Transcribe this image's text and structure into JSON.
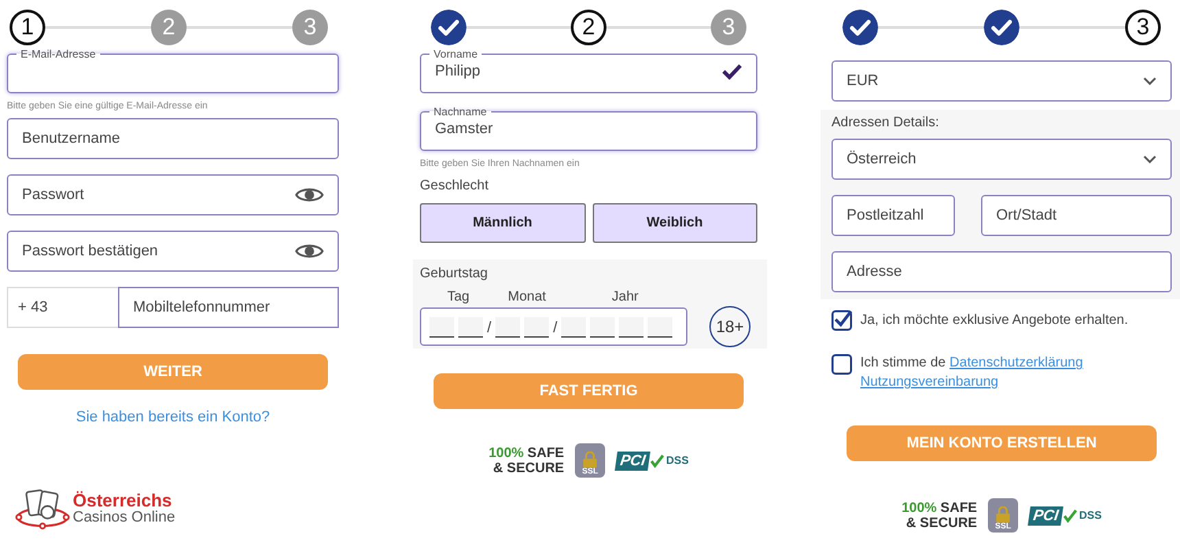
{
  "panels": [
    {
      "kind": "account",
      "steps": [
        {
          "done": false,
          "current": true,
          "label": "1"
        },
        {
          "done": false,
          "current": false,
          "label": "2"
        },
        {
          "done": false,
          "current": false,
          "label": "3"
        }
      ],
      "email": {
        "label": "E-Mail-Adresse",
        "hint": "Bitte geben Sie eine gültige E-Mail-Adresse ein"
      },
      "username": {
        "placeholder": "Benutzername"
      },
      "passwords": [
        {
          "placeholder": "Passwort"
        },
        {
          "placeholder": "Passwort bestätigen"
        }
      ],
      "phone": {
        "prefix": "+ 43",
        "placeholder": "Mobiltelefonnummer"
      },
      "button": "WEITER",
      "login_link": "Sie haben bereits ein Konto?",
      "logo": {
        "line_1": "Österreichs",
        "line_2": "Casinos Online"
      }
    },
    {
      "kind": "personal",
      "steps": [
        {
          "done": true
        },
        {
          "done": false,
          "current": true,
          "label": "2"
        },
        {
          "done": false,
          "current": false,
          "label": "3"
        }
      ],
      "first_name": {
        "label": "Vorname",
        "value": "Philipp",
        "valid": true
      },
      "last_name": {
        "label": "Nachname",
        "value": "Gamster",
        "hint": "Bitte geben Sie Ihren Nachnamen ein"
      },
      "gender": {
        "label": "Geschlecht",
        "options": [
          "Männlich",
          "Weiblich"
        ]
      },
      "birthday": {
        "label": "Geburtstag",
        "parts": [
          "Tag",
          "Monat",
          "Jahr"
        ],
        "separators": [
          "/",
          "/"
        ],
        "age_badge": "18+"
      },
      "button": "FAST FERTIG",
      "badges": {
        "safe": [
          "100%",
          "SAFE",
          "& SECURE"
        ],
        "ssl": "SSL",
        "pci": "PCI",
        "dss": "DSS"
      }
    },
    {
      "kind": "address",
      "steps": [
        {
          "done": true
        },
        {
          "done": true
        },
        {
          "done": false,
          "current": true,
          "label": "3"
        }
      ],
      "currency": {
        "value": "EUR"
      },
      "address": {
        "label": "Adressen Details:",
        "country": "Österreich",
        "postcode_placeholder": "Postleitzahl",
        "city_placeholder": "Ort/Stadt",
        "address_placeholder": "Adresse"
      },
      "consents": [
        {
          "checked": true,
          "text": "Ja, ich möchte exklusive Angebote erhalten."
        },
        {
          "checked": false,
          "text": "Ich stimme de",
          "links": [
            "Datenschutzerklärung",
            "Nutzungsvereinbarung"
          ]
        }
      ],
      "button": "MEIN KONTO ERSTELLEN",
      "badges": {
        "safe": [
          "100%",
          "SAFE",
          "& SECURE"
        ],
        "ssl": "SSL",
        "pci": "PCI",
        "dss": "DSS"
      }
    }
  ]
}
